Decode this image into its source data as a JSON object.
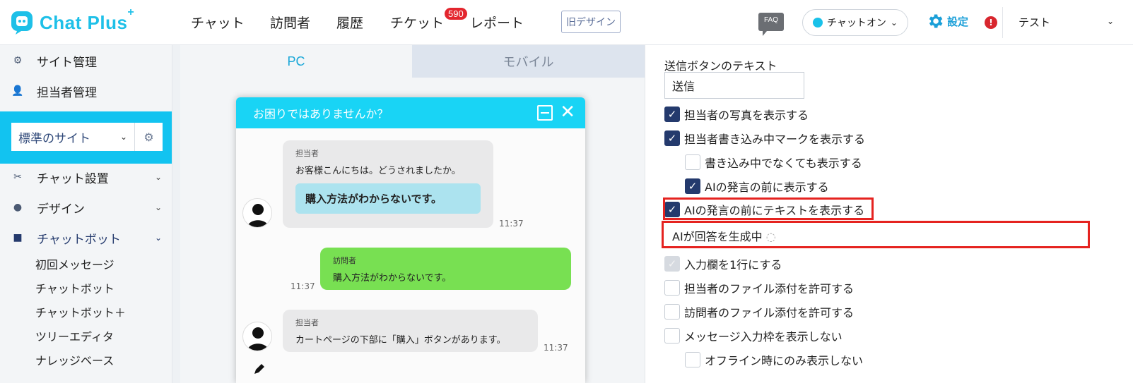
{
  "app": {
    "logo_text": "Chat Plus",
    "logo_plus": "+"
  },
  "nav": {
    "items": [
      "チャット",
      "訪問者",
      "履歴",
      "チケット",
      "レポート"
    ],
    "ticket_badge": "590",
    "old_design": "旧デザイン",
    "faq": "FAQ",
    "chat_status": "チャットオン",
    "settings": "設定",
    "alert": "!",
    "user": "テスト"
  },
  "sidebar": {
    "top_items": [
      "サイト管理",
      "担当者管理"
    ],
    "site_select": "標準のサイト",
    "sections": [
      "チャット設置",
      "デザイン",
      "チャットボット"
    ],
    "sub_items": [
      "初回メッセージ",
      "チャットボット",
      "チャットボット＋",
      "ツリーエディタ",
      "ナレッジベース"
    ]
  },
  "preview": {
    "tabs": [
      "PC",
      "モバイル"
    ],
    "widget_title": "お困りではありませんか？",
    "messages": [
      {
        "who": "担当者",
        "text": "お客様こんにちは。どうされましたか。",
        "button": "購入方法がわからないです。",
        "time": "11:37"
      },
      {
        "who": "訪問者",
        "text": "購入方法がわからないです。",
        "time": "11:37"
      },
      {
        "who": "担当者",
        "text": "カートページの下部に「購入」ボタンがあります。",
        "time": "11:37"
      }
    ]
  },
  "settings": {
    "send_label": "送信ボタンのテキスト",
    "send_value": "送信",
    "options": [
      {
        "label": "担当者の写真を表示する",
        "checked": true
      },
      {
        "label": "担当者書き込み中マークを表示する",
        "checked": true
      },
      {
        "label": "書き込み中でなくても表示する",
        "checked": false
      },
      {
        "label": "AIの発言の前に表示する",
        "checked": true
      },
      {
        "label": "AIの発言の前にテキストを表示する",
        "checked": true
      },
      {
        "label": "入力欄を1行にする",
        "checked": true,
        "disabled": true
      },
      {
        "label": "担当者のファイル添付を許可する",
        "checked": false
      },
      {
        "label": "訪問者のファイル添付を許可する",
        "checked": false
      },
      {
        "label": "メッセージ入力枠を表示しない",
        "checked": false
      },
      {
        "label": "オフライン時にのみ表示しない",
        "checked": false
      }
    ],
    "ai_text": "AIが回答を生成中"
  },
  "colors": {
    "brand": "#19d4f5",
    "highlight": "#e52320",
    "checkbox": "#243a6d",
    "visitor_bubble": "#78e052"
  }
}
